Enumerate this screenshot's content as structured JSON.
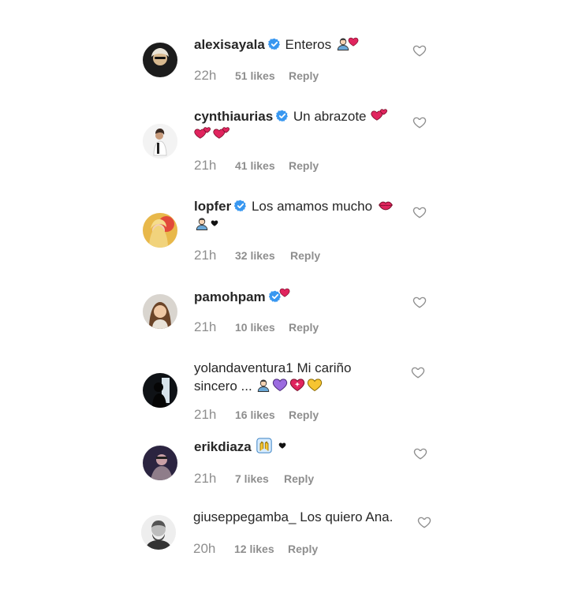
{
  "comments": [
    {
      "username": "alexisayala",
      "verified": true,
      "text": "Enteros",
      "time": "22h",
      "likes": "51 likes",
      "reply": "Reply"
    },
    {
      "username": "cynthiaurias",
      "verified": true,
      "text": "Un abrazote",
      "time": "21h",
      "likes": "41 likes",
      "reply": "Reply"
    },
    {
      "username": "lopfer",
      "verified": true,
      "text": "Los amamos mucho",
      "time": "21h",
      "likes": "32 likes",
      "reply": "Reply"
    },
    {
      "username": "pamohpam",
      "verified": true,
      "text": "",
      "time": "21h",
      "likes": "10 likes",
      "reply": "Reply"
    },
    {
      "username": "yolandaventura1",
      "verified": false,
      "text_line1": "Mi cariño",
      "text_line2": "sincero ...",
      "time": "21h",
      "likes": "16 likes",
      "reply": "Reply"
    },
    {
      "username": "erikdiaza",
      "verified": false,
      "text": "",
      "time": "21h",
      "likes": "7 likes",
      "reply": "Reply"
    },
    {
      "username": "giuseppegamba_",
      "verified": false,
      "text": "Los quiero Ana.",
      "time": "20h",
      "likes": "12 likes",
      "reply": "Reply"
    }
  ],
  "icons": {
    "verified": "verified-badge-icon",
    "like": "heart-outline-icon",
    "verified_color": "#3897f0",
    "emoji_red_heart": "#e0245e"
  }
}
